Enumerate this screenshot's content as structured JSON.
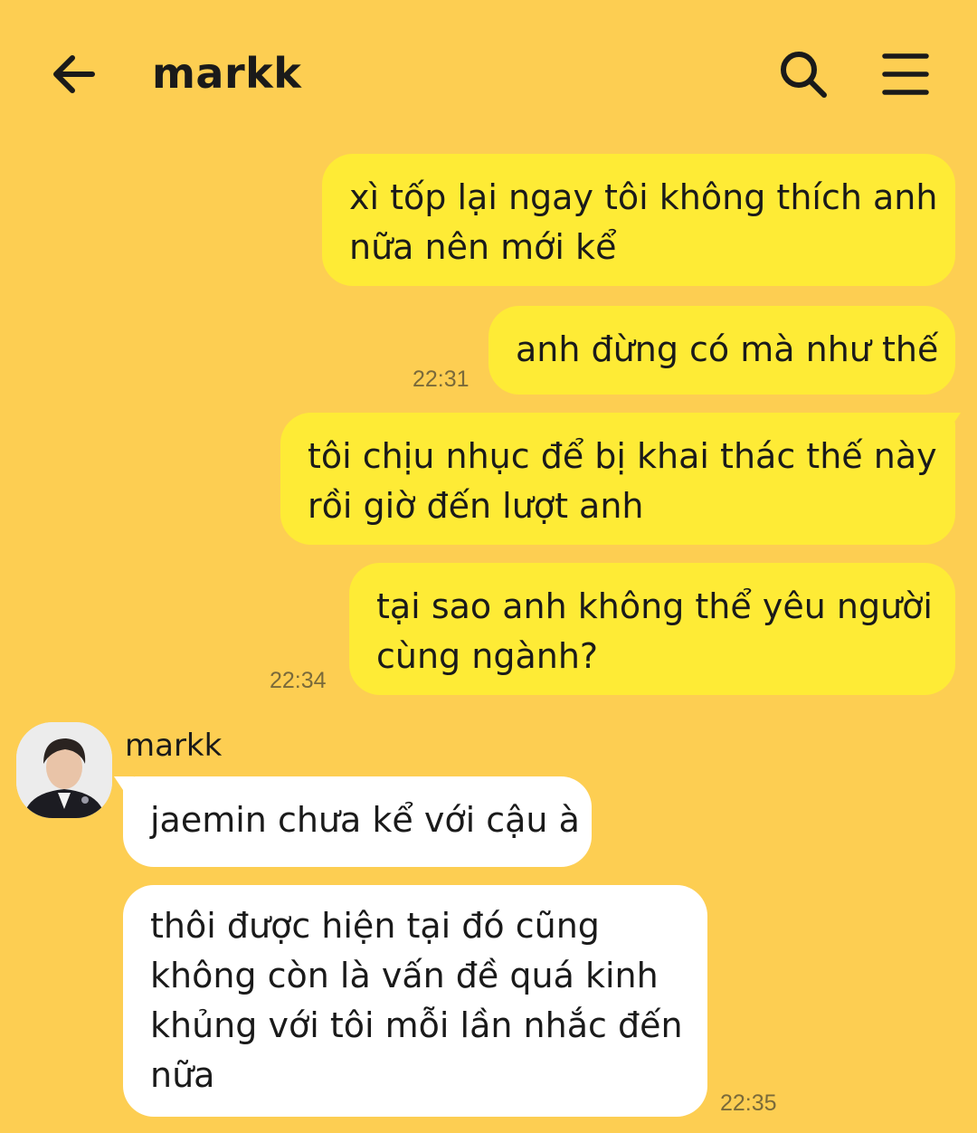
{
  "header": {
    "title": "markk"
  },
  "icons": {
    "back": "arrow-left-icon",
    "search": "search-icon",
    "menu": "hamburger-menu-icon"
  },
  "colors": {
    "background": "#FDCE52",
    "outgoing_bubble": "#FEEB36",
    "incoming_bubble": "#FFFFFF"
  },
  "messages": {
    "out1": {
      "line1": "xì tốp lại ngay tôi không thích anh",
      "line2": "nữa nên mới kể"
    },
    "out2": {
      "line1": "anh đừng có mà như thế",
      "time": "22:31"
    },
    "out3": {
      "line1": "tôi chịu nhục để bị khai thác thế này",
      "line2": "rồi giờ đến lượt anh"
    },
    "out4": {
      "line1": "tại sao anh không thể yêu người",
      "line2": "cùng ngành?",
      "time": "22:34"
    },
    "in": {
      "sender": "markk",
      "msg1": {
        "line1": "jaemin chưa kể với cậu à"
      },
      "msg2": {
        "line1": "thôi được hiện tại đó cũng",
        "line2": "không còn là vấn đề quá kinh",
        "line3": "khủng với tôi mỗi lần nhắc đến",
        "line4": "nữa",
        "time": "22:35"
      }
    }
  }
}
